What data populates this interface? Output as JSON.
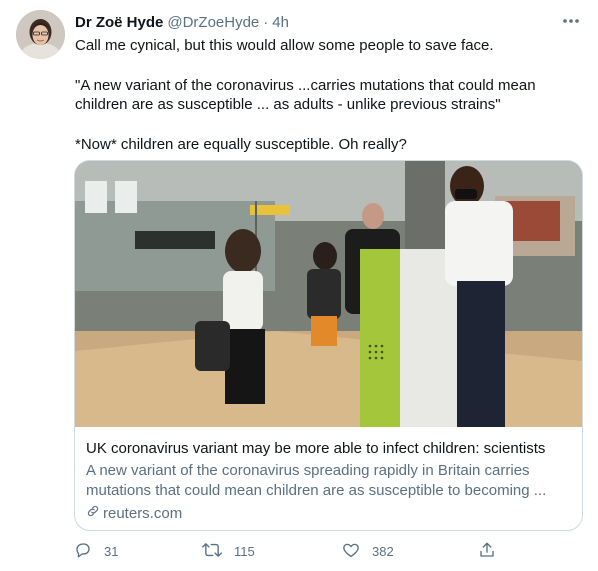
{
  "author": {
    "name": "Dr Zoë Hyde",
    "handle": "@DrZoeHyde",
    "separator": "·",
    "time": "4h"
  },
  "tweet": {
    "paragraphs": [
      "Call me cynical, but this would allow some people to save face.",
      "\"A new variant of the coronavirus ...carries mutations that could mean children are as susceptible ... as adults - unlike previous strains\"",
      "*Now* children are equally susceptible. Oh really?"
    ]
  },
  "card": {
    "title": "UK coronavirus variant may be more able to infect children: scientists",
    "description": "A new variant of the coronavirus spreading rapidly in Britain carries mutations that could mean children are as susceptible to becoming ...",
    "domain": "reuters.com",
    "image_alt": "Travellers wearing face masks at an airport check-in counter"
  },
  "actions": {
    "reply_count": "31",
    "retweet_count": "115",
    "like_count": "382"
  },
  "icons": {
    "more": "more-horizontal-icon",
    "reply": "reply-icon",
    "retweet": "retweet-icon",
    "like": "heart-icon",
    "share": "share-icon",
    "link": "link-icon"
  },
  "colors": {
    "text_primary": "#0f1419",
    "text_secondary": "#5b7083",
    "border": "#cfd9de"
  }
}
